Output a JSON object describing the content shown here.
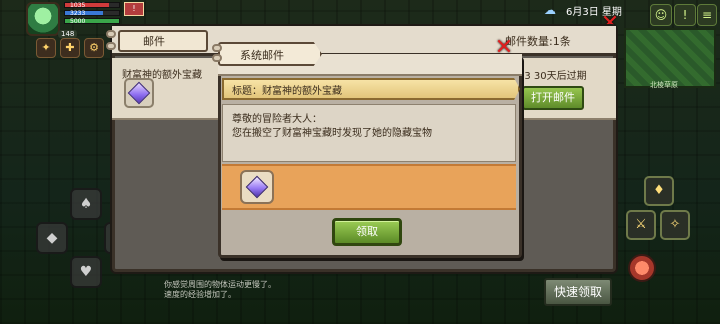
{
  "hud": {
    "hp_value": "1035",
    "mp_value": "3233",
    "sp_value": "5000",
    "level": "148",
    "date": "6月3日 星期",
    "minimap_label": "北棱草原"
  },
  "mail_window": {
    "title": "邮件",
    "count_label": "邮件数量:1条",
    "row_subject": "财富神的额外宝藏",
    "row_expiry": "23  30天后过期",
    "open_button": "打开邮件",
    "quick_claim_button": "快速领取"
  },
  "log": {
    "line1": "你感觉周围的物体运动更慢了。",
    "line2": "速度的经验增加了。"
  },
  "dialog": {
    "tab_title": "系统邮件",
    "subject": "标题：财富神的额外宝藏",
    "greeting": "尊敬的冒险者大人：",
    "message": "您在搬空了财富神宝藏时发现了她的隐藏宝物",
    "claim_button": "领取",
    "attachment_icon": "purple-gem-icon"
  },
  "icons": {
    "close": "close-icon",
    "weather": "weather-icon",
    "bag": "bag-icon"
  },
  "colors": {
    "panel_frame": "#3a3128",
    "attachment_bg": "#e8a35a",
    "claim_button": "#5b8a26",
    "close_red": "#e02020"
  }
}
